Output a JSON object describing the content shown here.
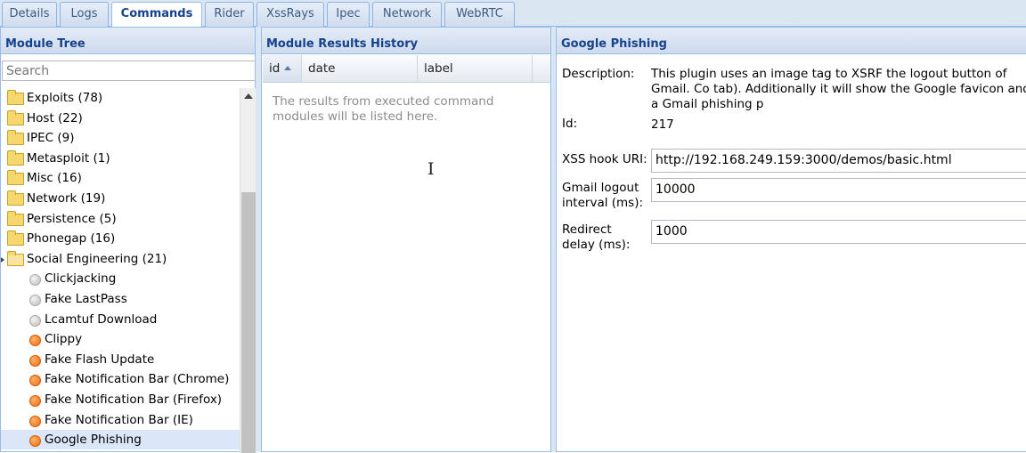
{
  "tabs": [
    {
      "label": "Details",
      "active": false
    },
    {
      "label": "Logs",
      "active": false
    },
    {
      "label": "Commands",
      "active": true
    },
    {
      "label": "Rider",
      "active": false
    },
    {
      "label": "XssRays",
      "active": false
    },
    {
      "label": "Ipec",
      "active": false
    },
    {
      "label": "Network",
      "active": false
    },
    {
      "label": "WebRTC",
      "active": false
    }
  ],
  "module_tree": {
    "title": "Module Tree",
    "search_placeholder": "Search",
    "items": [
      {
        "type": "folder",
        "label": "Exploits (78)"
      },
      {
        "type": "folder",
        "label": "Host (22)"
      },
      {
        "type": "folder",
        "label": "IPEC (9)"
      },
      {
        "type": "folder",
        "label": "Metasploit (1)"
      },
      {
        "type": "folder",
        "label": "Misc (16)"
      },
      {
        "type": "folder",
        "label": "Network (19)"
      },
      {
        "type": "folder",
        "label": "Persistence (5)"
      },
      {
        "type": "folder",
        "label": "Phonegap (16)"
      },
      {
        "type": "folder-open",
        "label": "Social Engineering (21)"
      },
      {
        "type": "leaf",
        "status": "gray",
        "label": "Clickjacking"
      },
      {
        "type": "leaf",
        "status": "gray",
        "label": "Fake LastPass"
      },
      {
        "type": "leaf",
        "status": "gray",
        "label": "Lcamtuf Download"
      },
      {
        "type": "leaf",
        "status": "orange",
        "label": "Clippy"
      },
      {
        "type": "leaf",
        "status": "orange",
        "label": "Fake Flash Update"
      },
      {
        "type": "leaf",
        "status": "orange",
        "label": "Fake Notification Bar (Chrome)"
      },
      {
        "type": "leaf",
        "status": "orange",
        "label": "Fake Notification Bar (Firefox)"
      },
      {
        "type": "leaf",
        "status": "orange",
        "label": "Fake Notification Bar (IE)"
      },
      {
        "type": "leaf",
        "status": "orange",
        "label": "Google Phishing",
        "selected": true
      }
    ]
  },
  "results_history": {
    "title": "Module Results History",
    "columns": [
      "id",
      "date",
      "label"
    ],
    "empty_message": "The results from executed command modules will be listed here."
  },
  "detail": {
    "title": "Google Phishing",
    "description_label": "Description:",
    "description": "This plugin uses an image tag to XSRF the logout button of Gmail. Co tab). Additionally it will show the Google favicon and a Gmail phishing p",
    "id_label": "Id:",
    "id_value": "217",
    "xss_hook_label": "XSS hook URI:",
    "xss_hook_value": "http://192.168.249.159:3000/demos/basic.html",
    "gmail_interval_label": "Gmail logout interval (ms):",
    "gmail_interval_value": "10000",
    "redirect_label": "Redirect delay (ms):",
    "redirect_value": "1000"
  },
  "colors": {
    "header_text": "#15428b",
    "panel_border": "#99bbe8",
    "selection": "#dbe6f8",
    "status_orange": "#f26a0c",
    "status_gray": "#bbbbbb"
  }
}
